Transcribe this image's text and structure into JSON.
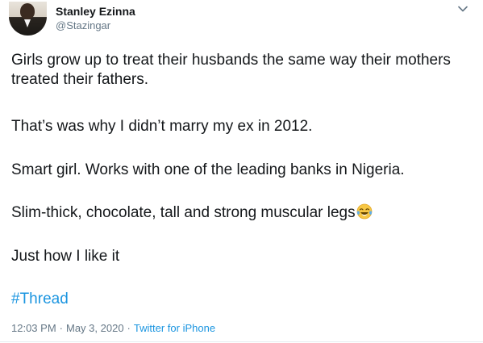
{
  "author": {
    "display_name": "Stanley Ezinna",
    "handle": "@Stazingar"
  },
  "tweet": {
    "paragraphs": [
      "Girls grow up to treat their husbands the same way their mothers treated their fathers.",
      "That’s was why I didn’t marry my ex in 2012.",
      "Smart girl. Works with one of the leading banks in Nigeria.",
      "Slim-thick, chocolate, tall and strong muscular legs",
      "Just how I like it"
    ],
    "emoji": "face-with-tears-of-joy-icon",
    "hashtag": "#Thread"
  },
  "meta": {
    "time": "12:03 PM",
    "separator": "·",
    "date": "May 3, 2020",
    "source": "Twitter for iPhone"
  },
  "colors": {
    "text": "#14171a",
    "secondary": "#657786",
    "link": "#1b95e0",
    "divider": "#e6ecf0"
  }
}
